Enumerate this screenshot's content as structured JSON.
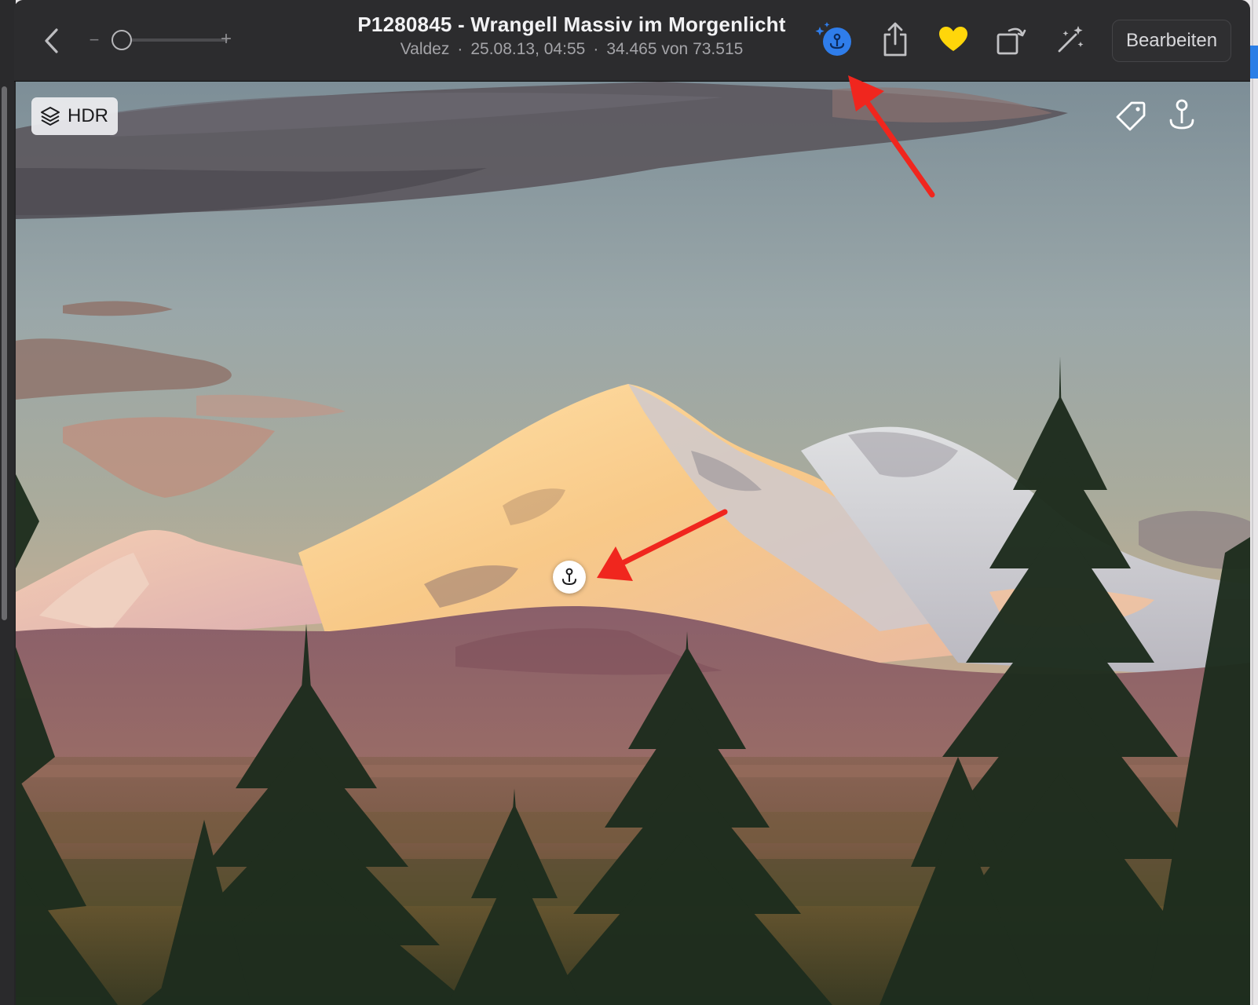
{
  "window": {
    "title": "P1280845 - Wrangell Massiv im Morgenlicht",
    "subtitle": {
      "location": "Valdez",
      "datetime": "25.08.13, 04:55",
      "position": "34.465 von 73.515"
    }
  },
  "toolbar": {
    "back_icon": "chevron-left-icon",
    "zoom_minus_label": "−",
    "zoom_plus_label": "+",
    "zoom_level": 0.0,
    "visual_lookup_icon": "visual-lookup-icon",
    "share_icon": "share-icon",
    "favorite_icon": "heart-icon",
    "rotate_icon": "rotate-icon",
    "enhance_icon": "magic-wand-icon",
    "edit_label": "Bearbeiten"
  },
  "photo": {
    "hdr_label": "HDR",
    "hdr_icon": "layers-icon",
    "tag_icon": "tag-icon",
    "lookup_pin_icon": "visual-lookup-pin-icon",
    "subject_pin_icon": "visual-lookup-pin-icon"
  },
  "colors": {
    "toolbar_bg": "#2c2c2e",
    "visual_lookup_active": "#2f7dea",
    "favorite_yellow": "#ffd60a",
    "annotation_red": "#f0261e"
  }
}
